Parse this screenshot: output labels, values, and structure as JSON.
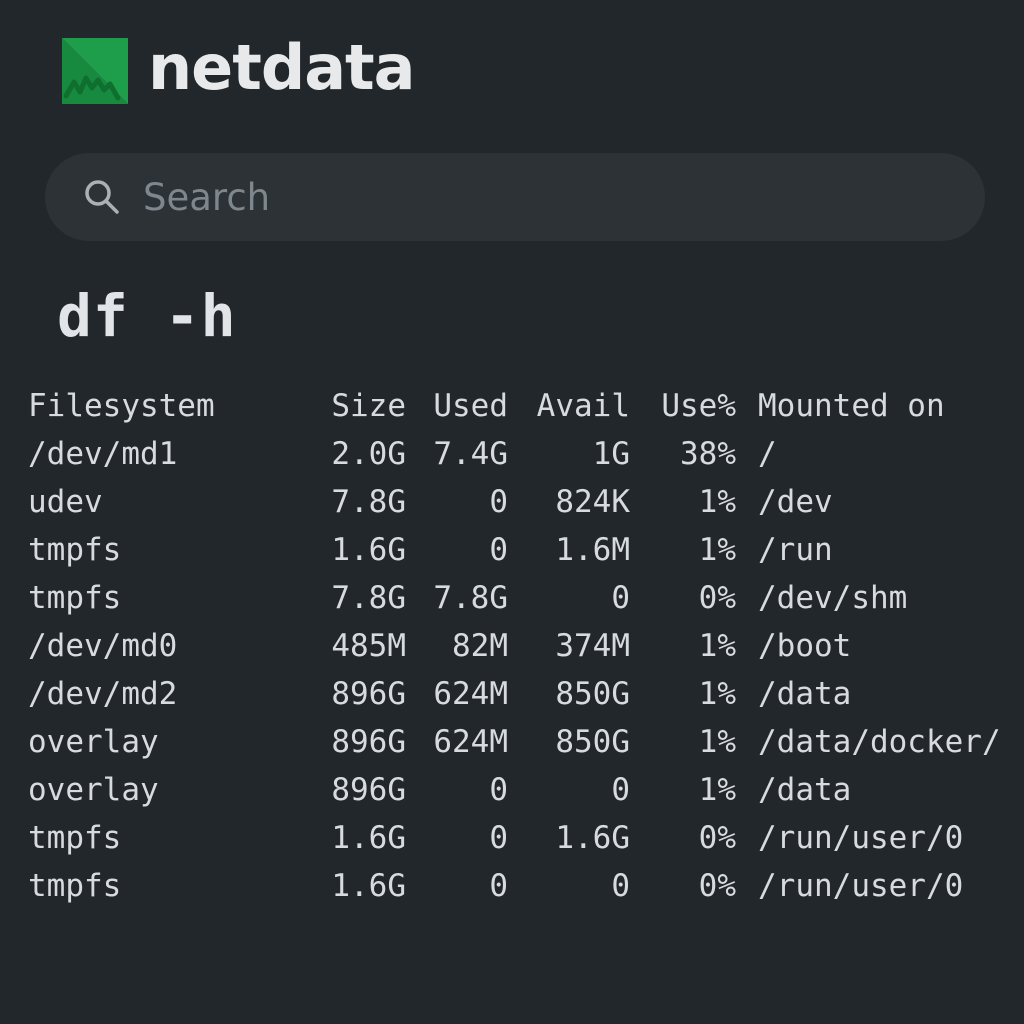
{
  "brand": {
    "name": "netdata",
    "logo_icon": "netdata-logo-icon",
    "logo_color": "#1e9d4a"
  },
  "search": {
    "placeholder": "Search",
    "value": "",
    "icon": "search-icon"
  },
  "command": {
    "title": "df -h"
  },
  "table": {
    "headers": [
      "Filesystem",
      "Size",
      "Used",
      "Avail",
      "Use%",
      "Mounted on"
    ],
    "rows": [
      [
        "/dev/md1",
        "2.0G",
        "7.4G",
        "1G",
        "38%",
        "/"
      ],
      [
        "udev",
        "7.8G",
        "0",
        "824K",
        "1%",
        "/dev"
      ],
      [
        "tmpfs",
        "1.6G",
        "0",
        "1.6M",
        "1%",
        "/run"
      ],
      [
        "tmpfs",
        "7.8G",
        "7.8G",
        "0",
        "0%",
        "/dev/shm"
      ],
      [
        "/dev/md0",
        "485M",
        "82M",
        "374M",
        "1%",
        "/boot"
      ],
      [
        "/dev/md2",
        "896G",
        "624M",
        "850G",
        "1%",
        "/data"
      ],
      [
        "overlay",
        "896G",
        "624M",
        "850G",
        "1%",
        "/data/docker/"
      ],
      [
        "overlay",
        "896G",
        "0",
        "0",
        "1%",
        "/data"
      ],
      [
        "tmpfs",
        "1.6G",
        "0",
        "1.6G",
        "0%",
        "/run/user/0"
      ],
      [
        "tmpfs",
        "1.6G",
        "0",
        "0",
        "0%",
        "/run/user/0"
      ]
    ]
  },
  "colors": {
    "background": "#22272b",
    "search_background": "#2c3236",
    "text": "#d7dbde",
    "placeholder": "#7e878d"
  }
}
